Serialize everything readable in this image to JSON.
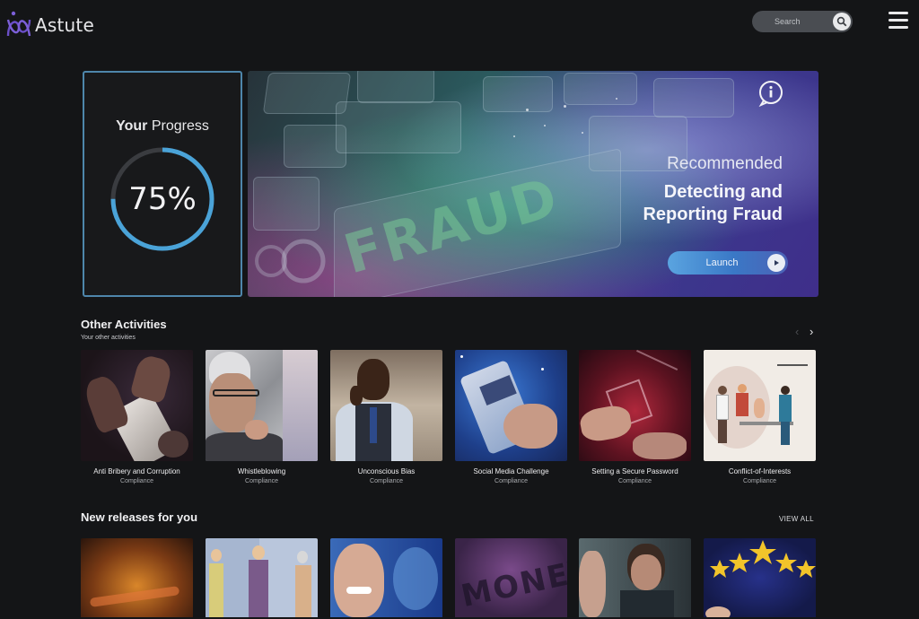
{
  "header": {
    "app_name": "Astute",
    "search_placeholder": "Search",
    "icons": {
      "logo": "astute-logo",
      "search": "search-icon",
      "menu": "menu-icon"
    }
  },
  "progress": {
    "title_bold": "Your",
    "title_rest": "Progress",
    "value_text": "75%",
    "value": 0.75
  },
  "hero": {
    "image_text": "FRAUD",
    "kicker": "Recommended",
    "title_line1": "Detecting and",
    "title_line2": "Reporting Fraud",
    "launch_label": "Launch",
    "icons": {
      "info": "info-icon",
      "play": "play-icon"
    }
  },
  "other_activities": {
    "title": "Other Activities",
    "subtitle": "Your other activities",
    "items": [
      {
        "title": "Anti Bribery and Corruption",
        "category": "Compliance"
      },
      {
        "title": "Whistleblowing",
        "category": "Compliance"
      },
      {
        "title": "Unconscious Bias",
        "category": "Compliance"
      },
      {
        "title": "Social Media Challenge",
        "category": "Compliance"
      },
      {
        "title": "Setting a Secure Password",
        "category": "Compliance"
      },
      {
        "title": "Conflict-of-Interests",
        "category": "Compliance"
      }
    ]
  },
  "new_releases": {
    "title": "New releases for you",
    "view_all": "VIEW ALL",
    "thumb_text": "MONEY"
  },
  "colors": {
    "background": "#141517",
    "accent_ring": "#4aa3d8",
    "card_border": "#4e86ab",
    "launch_button": "#4a8ad6"
  }
}
